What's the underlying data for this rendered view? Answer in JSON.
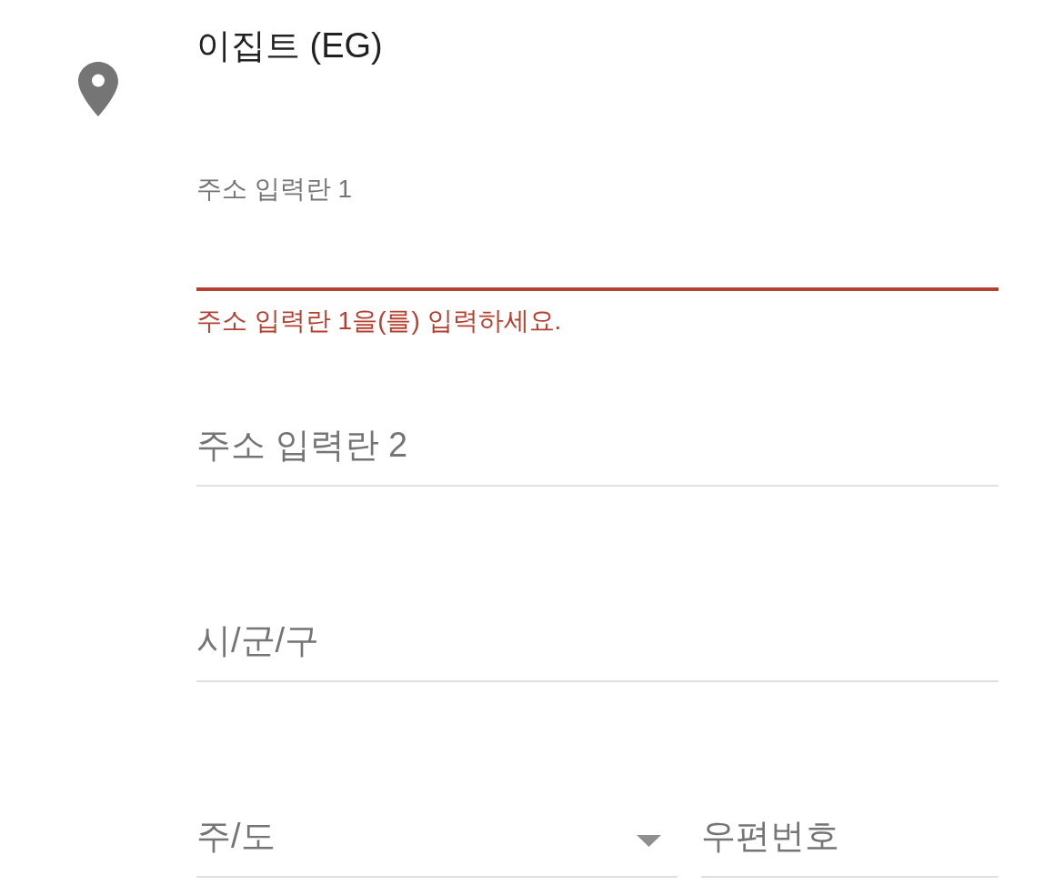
{
  "country": {
    "label": "이집트 (EG)"
  },
  "rows": [
    {
      "fields": [
        {
          "kind": "text",
          "label": "주소 입력란 1",
          "invalid": true,
          "error": "주소 입력란 1을(를) 입력하세요."
        }
      ]
    },
    {
      "fields": [
        {
          "kind": "text",
          "placeholder": "주소 입력란 2",
          "invalid": false
        }
      ]
    },
    {
      "fields": [
        {
          "kind": "text",
          "placeholder": "시/군/구",
          "invalid": false
        }
      ]
    },
    {
      "fields": [
        {
          "kind": "dropdown",
          "placeholder": "주/도",
          "invalid": false
        },
        {
          "kind": "text",
          "placeholder": "우편번호",
          "invalid": false
        }
      ]
    }
  ]
}
